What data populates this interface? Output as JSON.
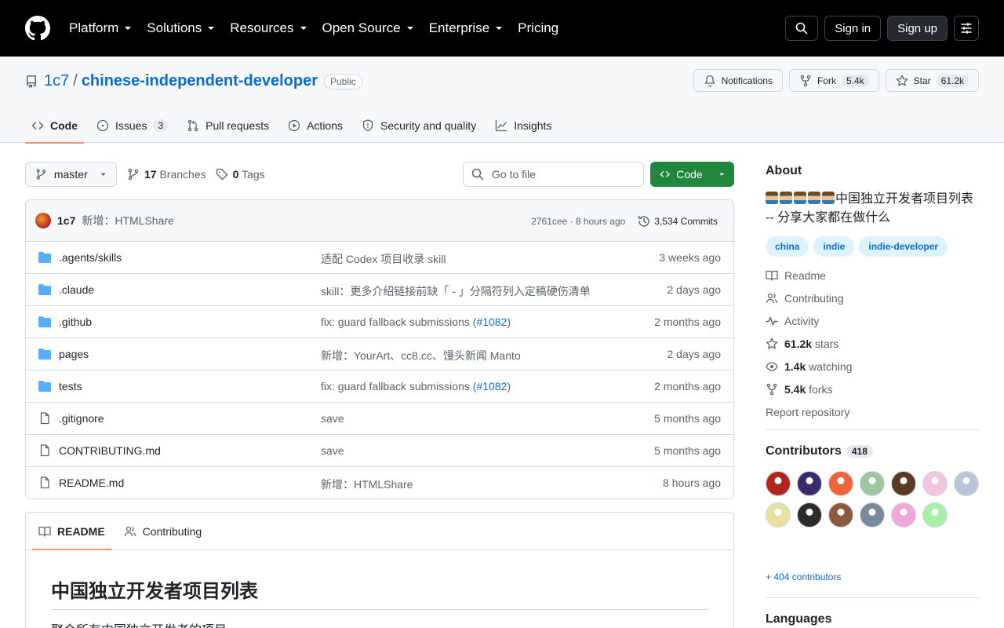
{
  "header": {
    "nav": [
      "Platform",
      "Solutions",
      "Resources",
      "Open Source",
      "Enterprise",
      "Pricing"
    ],
    "signin": "Sign in",
    "signup": "Sign up"
  },
  "repo": {
    "owner": "1c7",
    "separator": "/",
    "name": "chinese-independent-developer",
    "visibility": "Public",
    "notifications": "Notifications",
    "fork_label": "Fork",
    "fork_count": "5.4k",
    "star_label": "Star",
    "star_count": "61.2k"
  },
  "tabs": [
    {
      "label": "Code"
    },
    {
      "label": "Issues",
      "count": "3"
    },
    {
      "label": "Pull requests"
    },
    {
      "label": "Actions"
    },
    {
      "label": "Security and quality"
    },
    {
      "label": "Insights"
    }
  ],
  "toolbar": {
    "branch": "master",
    "branches_count": "17",
    "branches_label": "Branches",
    "tags_count": "0",
    "tags_label": "Tags",
    "goto_placeholder": "Go to file",
    "code_label": "Code"
  },
  "latest_commit": {
    "author": "1c7",
    "message": "新增：HTMLShare",
    "sha": "2761cee",
    "dot": "·",
    "time": "8 hours ago",
    "commits": "3,534 Commits"
  },
  "files": [
    {
      "type": "dir",
      "name": ".agents/skills",
      "msg": "适配 Codex 项目收录 skill",
      "date": "3 weeks ago"
    },
    {
      "type": "dir",
      "name": ".claude",
      "msg": "skill：更多介绍链接前缺「 - 」分隔符列入定稿硬伤清单",
      "date": "2 days ago"
    },
    {
      "type": "dir",
      "name": ".github",
      "msg": "fix: guard fallback submissions (",
      "pr": "#1082",
      "msg_end": ")",
      "date": "2 months ago"
    },
    {
      "type": "dir",
      "name": "pages",
      "msg": "新增：YourArt、cc8.cc、馒头新闻 Manto",
      "date": "2 days ago"
    },
    {
      "type": "dir",
      "name": "tests",
      "msg": "fix: guard fallback submissions (",
      "pr": "#1082",
      "msg_end": ")",
      "date": "2 months ago"
    },
    {
      "type": "file",
      "name": ".gitignore",
      "msg": "save",
      "date": "5 months ago"
    },
    {
      "type": "file",
      "name": "CONTRIBUTING.md",
      "msg": "save",
      "date": "5 months ago"
    },
    {
      "type": "file",
      "name": "README.md",
      "msg": "新增：HTMLShare",
      "date": "8 hours ago"
    }
  ],
  "readme": {
    "tab_readme": "README",
    "tab_contributing": "Contributing",
    "h1": "中国独立开发者项目列表",
    "p": "聚合所有中国独立开发者的项目"
  },
  "about": {
    "title": "About",
    "description": "中国独立开发者项目列表 -- 分享大家都在做什么",
    "topics": [
      "china",
      "indie",
      "indie-developer"
    ],
    "readme": "Readme",
    "contributing": "Contributing",
    "activity": "Activity",
    "stars_count": "61.2k",
    "stars_label": "stars",
    "watching_count": "1.4k",
    "watching_label": "watching",
    "forks_count": "5.4k",
    "forks_label": "forks",
    "report": "Report repository"
  },
  "contributors": {
    "title": "Contributors",
    "count": "418",
    "more": "+ 404 contributors",
    "avatar_colors": [
      "#b3261e",
      "#3a2a6e",
      "#f0643c",
      "#9ec5a0",
      "#5a3a22",
      "#f2c4e0",
      "#b9c6d8",
      "#e8e0a0",
      "#2b2b2b",
      "#8b5a3c",
      "#7a8a9a",
      "#f0a8d8",
      "#a8f0a8"
    ]
  },
  "languages": {
    "title": "Languages"
  }
}
